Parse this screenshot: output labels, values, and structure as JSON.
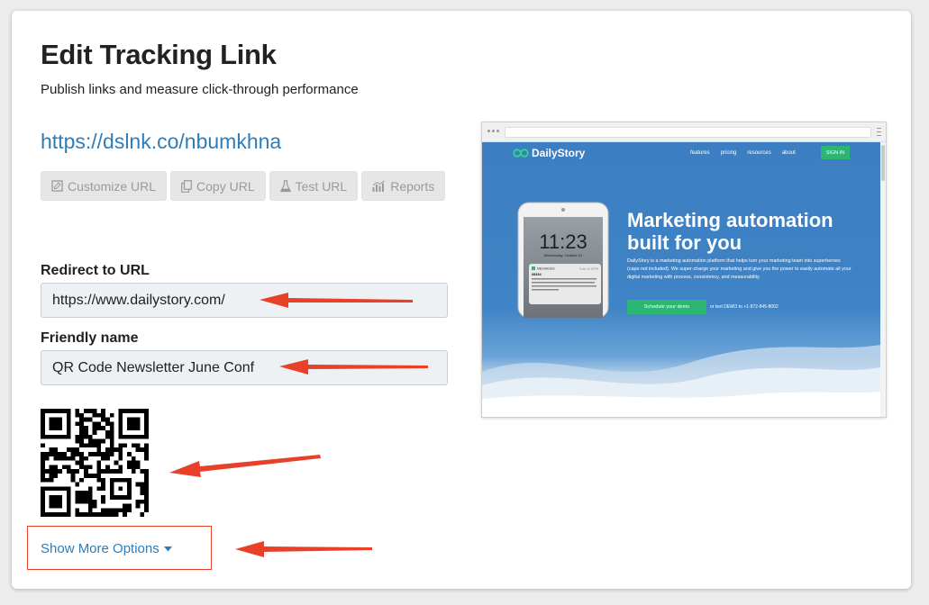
{
  "page": {
    "title": "Edit Tracking Link",
    "subtitle": "Publish links and measure click-through performance",
    "short_link": "https://dslnk.co/nbumkhna"
  },
  "buttons": [
    {
      "label": "Customize URL",
      "icon": "edit-icon"
    },
    {
      "label": "Copy URL",
      "icon": "copy-icon"
    },
    {
      "label": "Test URL",
      "icon": "flask-icon"
    },
    {
      "label": "Reports",
      "icon": "bar-chart-icon"
    }
  ],
  "form": {
    "redirect_label": "Redirect to URL",
    "redirect_value": "https://www.dailystory.com/",
    "friendly_label": "Friendly name",
    "friendly_value": "QR Code Newsletter June Conf"
  },
  "more_options": {
    "label": "Show More Options",
    "icon": "caret-down-icon"
  },
  "preview": {
    "brand": "DailyStory",
    "nav": [
      "features",
      "pricing",
      "resources",
      "about"
    ],
    "signin": "SIGN IN",
    "hero_title": "Marketing automation built for you",
    "hero_text": "DailyStory is a marketing automation platform that helps turn your marketing team into superheroes (cape not included). We super-charge your marketing and give you the power to easily automate all your digital marketing with process, consistency, and measurability.",
    "cta": "Schedule your demo",
    "cta_alt": "or text DEMO to +1-972-845-8002",
    "phone_time": "11:23",
    "phone_date": "Wednesday, October 21",
    "phone_msg_app": "MESSAGES",
    "phone_msg_time": "Today 11:18 PM",
    "phone_msg_sender": "68334",
    "phone_msg_body": "Hi Anne - thanks for visiting DailyStory. We're looking forward to learning more about your marketing automation needs."
  },
  "colors": {
    "link": "#2f7db8",
    "annotation": "#e8412a",
    "site_blue": "#3b7ec1",
    "site_green": "#2bb673"
  }
}
